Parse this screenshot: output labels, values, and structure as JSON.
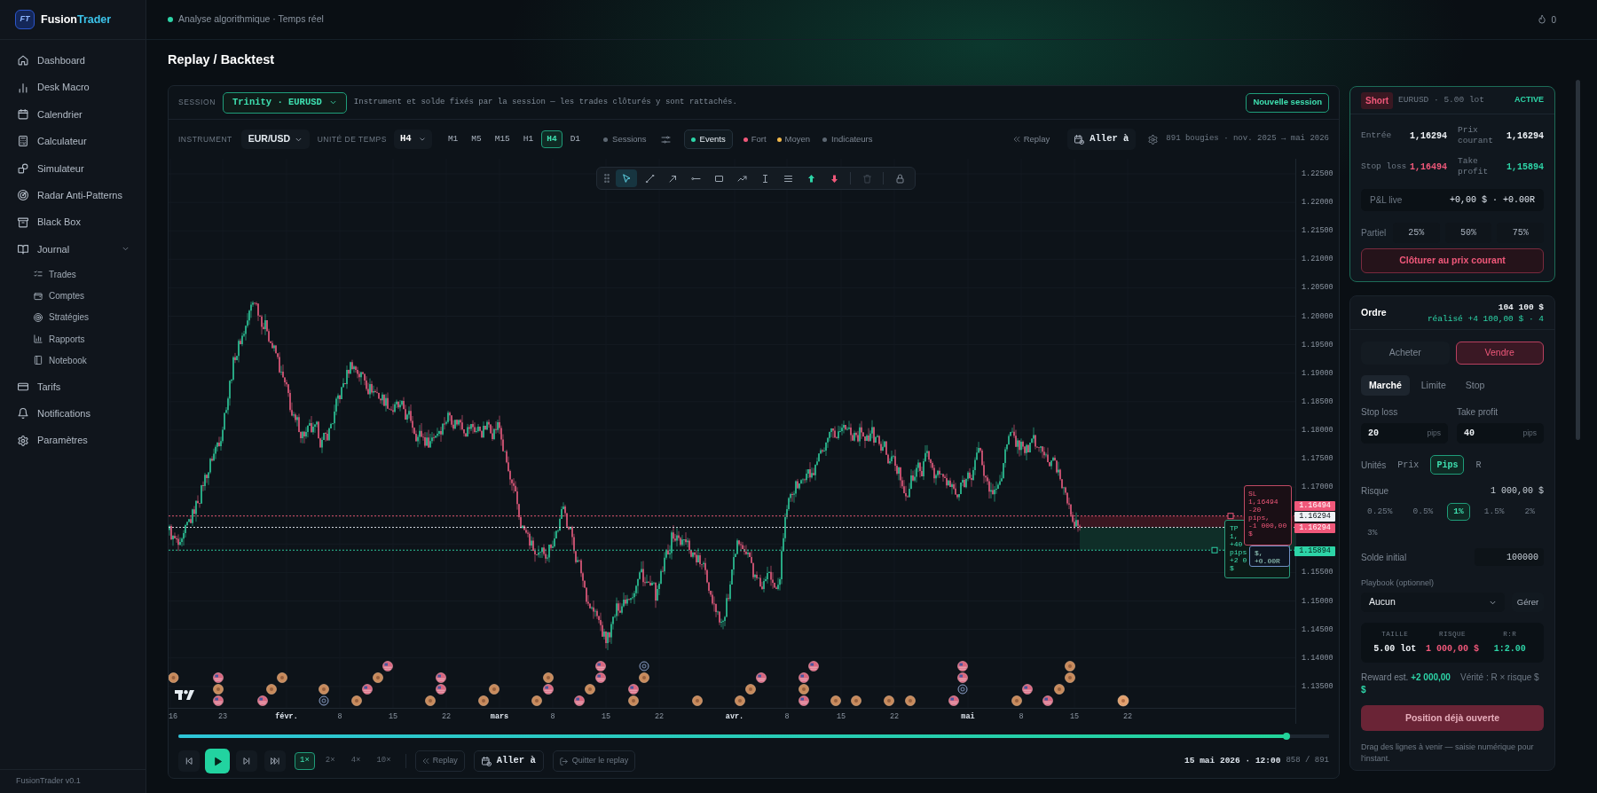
{
  "sidebar": {
    "logo": "FT",
    "brand": {
      "first": "Fusion",
      "second": "Trader"
    },
    "items": [
      {
        "label": "Dashboard",
        "selected": false
      },
      {
        "label": "Desk Macro",
        "selected": false
      },
      {
        "label": "Calendrier",
        "selected": false
      },
      {
        "label": "Calculateur",
        "selected": false
      },
      {
        "label": "Simulateur",
        "selected": false
      },
      {
        "label": "Radar Anti-Patterns",
        "selected": false
      },
      {
        "label": "Black Box",
        "selected": false
      },
      {
        "label": "Journal",
        "selected": false,
        "expanded": true,
        "children": [
          {
            "label": "Trades",
            "selected": false
          },
          {
            "label": "Comptes",
            "selected": false
          },
          {
            "label": "Stratégies",
            "selected": false
          },
          {
            "label": "Rapports",
            "selected": false
          },
          {
            "label": "Notebook",
            "selected": false
          }
        ]
      },
      {
        "label": "Tarifs",
        "selected": false
      },
      {
        "label": "Notifications",
        "selected": false
      },
      {
        "label": "Paramètres",
        "selected": false
      }
    ],
    "version": "FusionTrader v0.1"
  },
  "header": {
    "live": true,
    "status": "Analyse algorithmique · Temps réel",
    "streak": "0"
  },
  "page_title": "Replay / Backtest",
  "session_bar": {
    "label": "SESSION",
    "session": "Trinity · EURUSD",
    "note": "Instrument et solde fixés par la session — les trades clôturés y sont rattachés.",
    "new_session": "Nouvelle session"
  },
  "toolbar": {
    "instrument_label": "INSTRUMENT",
    "instrument": "EUR/USD",
    "timeframe_label": "UNITÉ DE TEMPS",
    "timeframe": "H4",
    "timeframes": [
      {
        "label": "M1",
        "selected": false
      },
      {
        "label": "M5",
        "selected": false
      },
      {
        "label": "M15",
        "selected": false
      },
      {
        "label": "H1",
        "selected": false
      },
      {
        "label": "H4",
        "selected": true
      },
      {
        "label": "D1",
        "selected": false
      }
    ],
    "layers": [
      {
        "kind": "toggle",
        "label": "Sessions",
        "on": false
      },
      {
        "kind": "settings"
      },
      {
        "kind": "toggle",
        "label": "Events",
        "on": true
      },
      {
        "kind": "legend",
        "label": "Fort",
        "color": "#f0587a"
      },
      {
        "kind": "legend",
        "label": "Moyen",
        "color": "#f2b84b"
      },
      {
        "kind": "toggle",
        "label": "Indicateurs",
        "on": false
      }
    ],
    "replay": "Replay",
    "go_to": "Aller à",
    "range": "891 bougies · nov. 2025 → mai 2026"
  },
  "drawing_tools": [
    {
      "kind": "cursor",
      "selected": true
    },
    {
      "kind": "line",
      "selected": false
    },
    {
      "kind": "arrow",
      "selected": false
    },
    {
      "kind": "ray",
      "selected": false
    },
    {
      "kind": "rectangle",
      "selected": false
    },
    {
      "kind": "path",
      "selected": false
    },
    {
      "kind": "measure",
      "selected": false
    },
    {
      "kind": "levels",
      "selected": false
    },
    {
      "kind": "long",
      "selected": false
    },
    {
      "kind": "short",
      "selected": false
    }
  ],
  "delete_tool": {
    "disabled": true
  },
  "chart": {
    "price_ticks": [
      "1.22500",
      "1.22000",
      "1.21500",
      "1.21000",
      "1.20500",
      "1.20000",
      "1.19500",
      "1.19000",
      "1.18500",
      "1.18000",
      "1.17500",
      "1.17000",
      "1.15500",
      "1.15000",
      "1.14500",
      "1.14000",
      "1.13500"
    ],
    "price_tags": [
      {
        "kind": "stop",
        "text": "1.16494"
      },
      {
        "kind": "entry",
        "text": "1.16294"
      },
      {
        "kind": "last",
        "text": "1.16294"
      },
      {
        "kind": "target",
        "text": "1.15894"
      }
    ],
    "date_labels": [
      {
        "kind": "day",
        "text": "16"
      },
      {
        "kind": "day",
        "text": "23"
      },
      {
        "kind": "month",
        "text": "févr."
      },
      {
        "kind": "day",
        "text": "8"
      },
      {
        "kind": "day",
        "text": "15"
      },
      {
        "kind": "day",
        "text": "22"
      },
      {
        "kind": "month",
        "text": "mars"
      },
      {
        "kind": "day",
        "text": "8"
      },
      {
        "kind": "day",
        "text": "15"
      },
      {
        "kind": "day",
        "text": "22"
      },
      {
        "kind": "month",
        "text": "avr."
      },
      {
        "kind": "day",
        "text": "8"
      },
      {
        "kind": "day",
        "text": "15"
      },
      {
        "kind": "day",
        "text": "22"
      },
      {
        "kind": "month",
        "text": "mai"
      },
      {
        "kind": "day",
        "text": "8"
      },
      {
        "kind": "day",
        "text": "15"
      },
      {
        "kind": "day",
        "text": "22"
      }
    ],
    "tooltips": [
      {
        "kind": "stop",
        "text": "SL\n1,16494\n-20\npips,\n-1 000,00\n$"
      },
      {
        "kind": "target",
        "text": "TP\n1,\n+40\npips\n+2 0\n$"
      },
      {
        "kind": "entry",
        "text": "$,\n+0.00R"
      }
    ]
  },
  "replay": {
    "level": 0.963,
    "playing": false,
    "speeds": [
      {
        "label": "1×",
        "selected": true
      },
      {
        "label": "2×",
        "selected": false
      },
      {
        "label": "4×",
        "selected": false
      },
      {
        "label": "10×",
        "selected": false
      }
    ],
    "replay": "Replay",
    "go_to": "Aller à",
    "quit": "Quitter le replay",
    "datetime": "15 mai 2026 · 12:00",
    "counter": "858 / 891"
  },
  "position": {
    "kind": "short",
    "side": "Short",
    "summary": "EURUSD · 5.00 lot",
    "status": "ACTIVE",
    "fields": [
      {
        "kind": "entry",
        "label": "Entrée",
        "value": "1,16294"
      },
      {
        "kind": "current",
        "label": "Prix courant",
        "value": "1,16294"
      },
      {
        "kind": "stop",
        "label": "Stop loss",
        "value": "1,16494"
      },
      {
        "kind": "target",
        "label": "Take profit",
        "value": "1,15894"
      }
    ],
    "pnl": {
      "label": "P&L live",
      "value": "+0,00 $ · +0.00R"
    },
    "partial": {
      "label": "Partiel",
      "options": [
        "25%",
        "50%",
        "75%"
      ]
    },
    "close": "Clôturer au prix courant"
  },
  "order": {
    "title": "Ordre",
    "balance": "104 100 $",
    "realized": "réalisé +4 100,00 $ · 4",
    "sides": [
      {
        "kind": "buy",
        "label": "Acheter",
        "selected": false
      },
      {
        "kind": "sell",
        "label": "Vendre",
        "selected": true
      }
    ],
    "types": [
      {
        "label": "Marché",
        "selected": true
      },
      {
        "label": "Limite",
        "selected": false
      },
      {
        "label": "Stop",
        "selected": false
      }
    ],
    "stop_loss": {
      "label": "Stop loss",
      "value": "20",
      "unit": "pips"
    },
    "take_profit": {
      "label": "Take profit",
      "value": "40",
      "unit": "pips"
    },
    "units": {
      "label": "Unités",
      "options": [
        {
          "label": "Prix",
          "selected": false
        },
        {
          "label": "Pips",
          "selected": true
        },
        {
          "label": "R",
          "selected": false
        }
      ]
    },
    "risk": {
      "label": "Risque",
      "value": "1 000,00 $",
      "options": [
        {
          "label": "0.25%",
          "selected": false
        },
        {
          "label": "0.5%",
          "selected": false
        },
        {
          "label": "1%",
          "selected": true
        },
        {
          "label": "1.5%",
          "selected": false
        },
        {
          "label": "2%",
          "selected": false
        },
        {
          "label": "3%",
          "selected": false
        }
      ]
    },
    "initial_balance": {
      "label": "Solde initial",
      "value": "100000"
    },
    "playbook": {
      "label": "Playbook (optionnel)",
      "value": "Aucun",
      "manage": "Gérer"
    },
    "summary": [
      {
        "kind": "size",
        "label": "TAILLE",
        "value": "5.00 lot"
      },
      {
        "kind": "risk",
        "label": "RISQUE",
        "value": "1 000,00 $"
      },
      {
        "kind": "ratio",
        "label": "R:R",
        "value": "1:2.00"
      }
    ],
    "reward": {
      "label": "Reward est.",
      "value": "+2 000,00 $"
    },
    "truth": "Vérité : R × risque $",
    "submit": {
      "label": "Position déjà ouverte",
      "disabled": true
    },
    "footnote": "Drag des lignes à venir — saisie numérique pour l'instant."
  }
}
